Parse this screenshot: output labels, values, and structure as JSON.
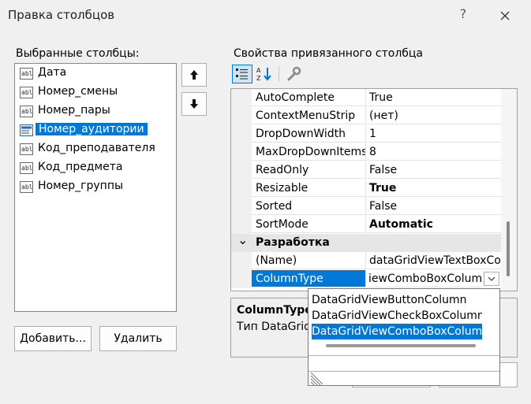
{
  "window": {
    "title": "Правка столбцов",
    "help_label": "?"
  },
  "left": {
    "label": "Выбранные столбцы:",
    "items": [
      {
        "label": "Дата"
      },
      {
        "label": "Номер_смены"
      },
      {
        "label": "Номер_пары"
      },
      {
        "label": "Номер_аудитории",
        "selected": true
      },
      {
        "label": "Код_преподавателя"
      },
      {
        "label": "Код_предмета"
      },
      {
        "label": "Номер_группы"
      }
    ],
    "add_button": "Добавить...",
    "remove_button": "Удалить"
  },
  "right": {
    "label": "Свойства привязанного столбца",
    "properties": [
      {
        "name": "AutoComplete",
        "value": "True"
      },
      {
        "name": "ContextMenuStrip",
        "value": "(нет)"
      },
      {
        "name": "DropDownWidth",
        "value": "1"
      },
      {
        "name": "MaxDropDownItems",
        "value": "8"
      },
      {
        "name": "ReadOnly",
        "value": "False"
      },
      {
        "name": "Resizable",
        "value": "True",
        "bold": true
      },
      {
        "name": "Sorted",
        "value": "False"
      },
      {
        "name": "SortMode",
        "value": "Automatic",
        "bold": true
      }
    ],
    "category": "Разработка",
    "category_toggle": "⌄",
    "design_properties": [
      {
        "name": "(Name)",
        "value": "dataGridViewTextBoxColu"
      },
      {
        "name": "ColumnType",
        "value": "iewComboBoxColumn"
      }
    ],
    "description": {
      "title": "ColumnType",
      "text": "Тип DataGrid"
    },
    "dropdown_options": [
      "DataGridViewButtonColumn",
      "DataGridViewCheckBoxColumn",
      "DataGridViewComboBoxColumn"
    ],
    "dropdown_selected_index": 2
  },
  "colors": {
    "accent": "#0078d7"
  }
}
